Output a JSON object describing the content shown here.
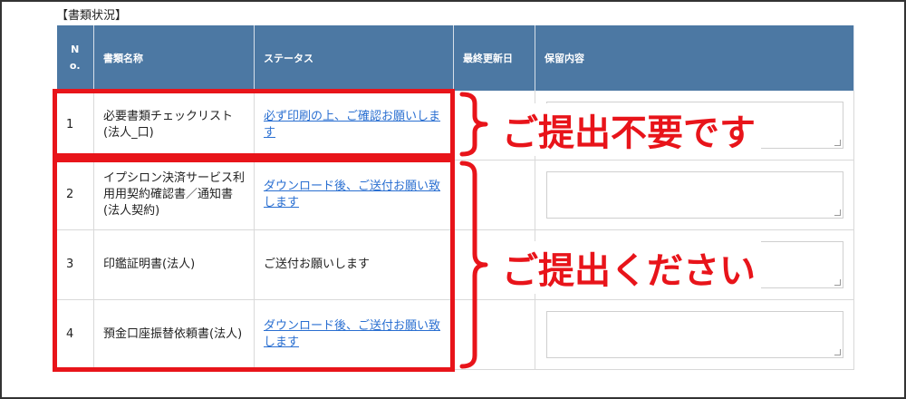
{
  "section_title": "【書類状況】",
  "table": {
    "headers": {
      "no": "No.",
      "name": "書類名称",
      "status": "ステータス",
      "updated": "最終更新日",
      "memo": "保留内容"
    },
    "rows": [
      {
        "no": "1",
        "name": "必要書類チェックリスト(法人_口)",
        "status": "必ず印刷の上、ご確認お願いします",
        "status_link": true,
        "updated": ""
      },
      {
        "no": "2",
        "name": "イプシロン決済サービス利用用契約確認書／通知書(法人契約)",
        "status": "ダウンロード後、ご送付お願い致します",
        "status_link": true,
        "updated": ""
      },
      {
        "no": "3",
        "name": "印鑑証明書(法人)",
        "status": "ご送付お願いします",
        "status_link": false,
        "updated": ""
      },
      {
        "no": "4",
        "name": "預金口座振替依頼書(法人)",
        "status": "ダウンロード後、ご送付お願い致します",
        "status_link": true,
        "updated": ""
      }
    ]
  },
  "annotations": {
    "not_required": "ご提出不要です",
    "please_submit": "ご提出ください",
    "highlight_color": "#e8141a"
  }
}
